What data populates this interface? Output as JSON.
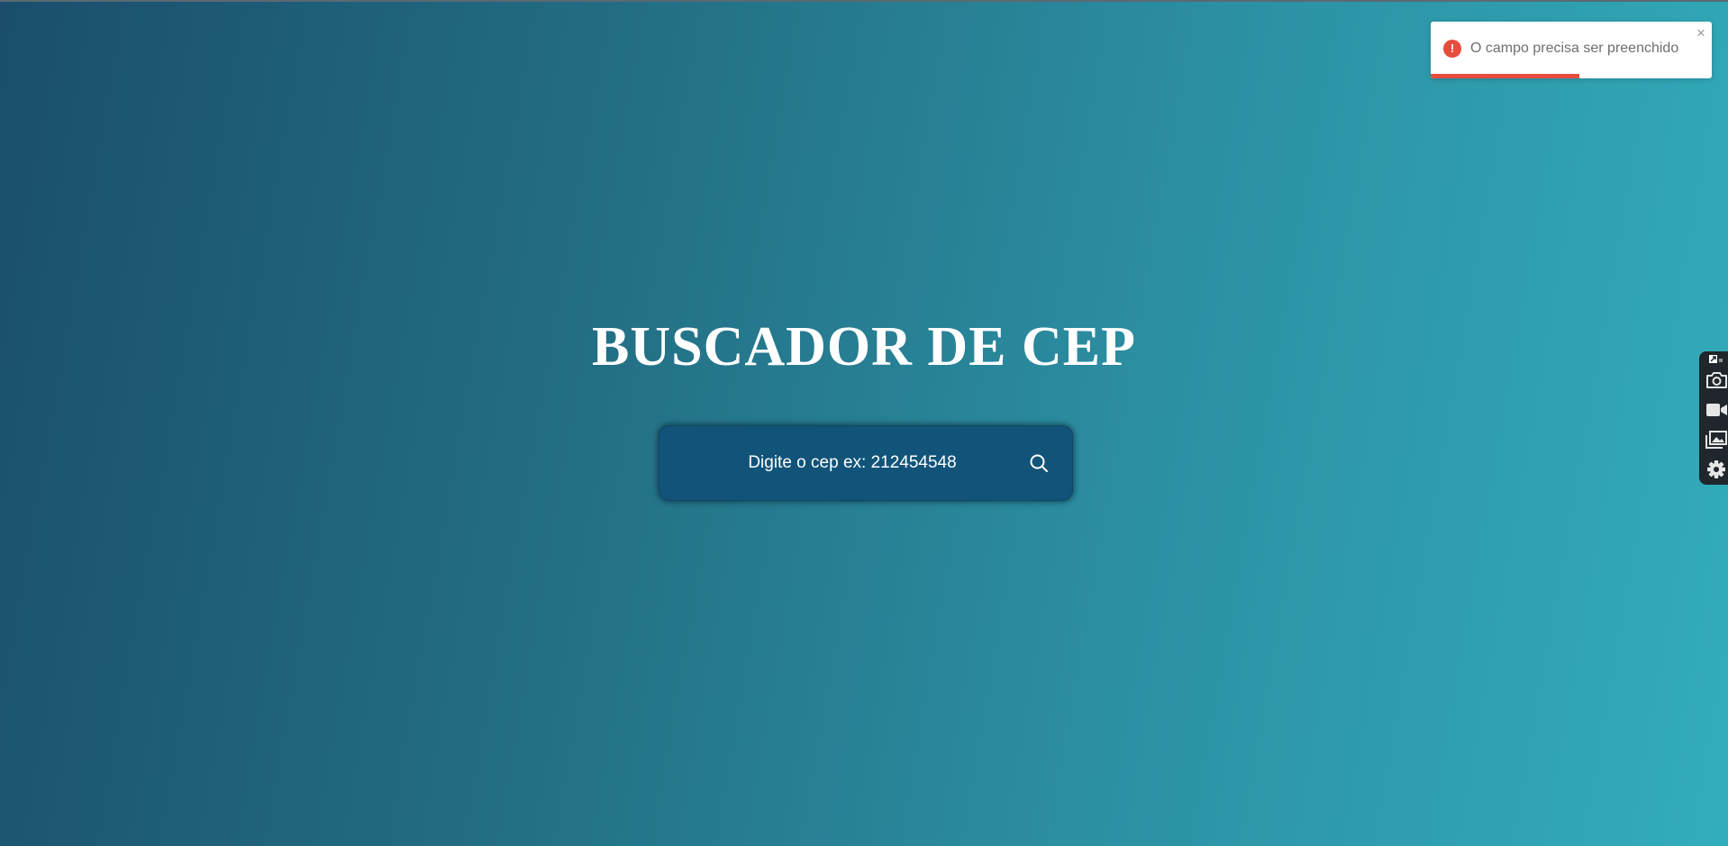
{
  "page": {
    "title": "BUSCADOR DE CEP"
  },
  "search": {
    "placeholder": "Digite o cep ex: 212454548",
    "value": "",
    "button_icon": "search-icon"
  },
  "toast": {
    "type": "error",
    "icon": "error-circle-icon",
    "icon_glyph": "!",
    "message": "O campo precisa ser preenchido",
    "close_glyph": "×",
    "progress": 0.53,
    "accent_color": "#e74c3c"
  },
  "side_toolbar": {
    "items": [
      {
        "icon": "pin-icon"
      },
      {
        "icon": "camera-icon"
      },
      {
        "icon": "video-icon"
      },
      {
        "icon": "gallery-icon"
      },
      {
        "icon": "gear-icon"
      }
    ]
  },
  "colors": {
    "background_start": "#1a4e6c",
    "background_end": "#32adbb",
    "search_box": "#125479",
    "text": "#ffffff"
  }
}
